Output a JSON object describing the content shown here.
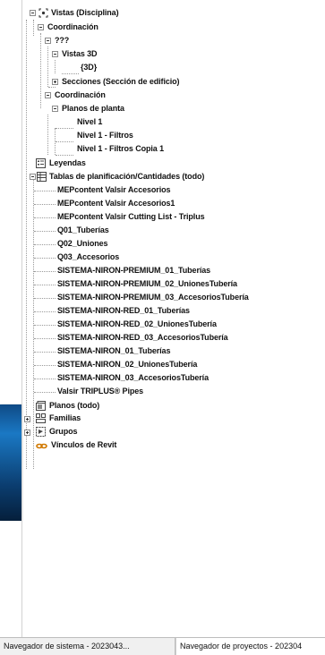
{
  "tree": {
    "vistas": "Vistas (Disciplina)",
    "coordinacion_1": "Coordinación",
    "unknown": "???",
    "vistas3d": "Vistas 3D",
    "view3d": "{3D}",
    "secciones": "Secciones (Sección de edificio)",
    "coordinacion_2": "Coordinación",
    "planos_planta": "Planos de planta",
    "nivel1": "Nivel 1",
    "nivel1_filtros": "Nivel 1 - Filtros",
    "nivel1_filtros_copia": "Nivel 1 - Filtros Copia 1",
    "leyendas": "Leyendas",
    "tablas": "Tablas de planificación/Cantidades (todo)",
    "schedules": [
      "MEPcontent Valsir Accesorios",
      "MEPcontent Valsir Accesorios1",
      "MEPcontent Valsir Cutting List - Triplus",
      "Q01_Tuberías",
      "Q02_Uniones",
      "Q03_Accesorios",
      "SISTEMA-NIRON-PREMIUM_01_Tuberías",
      "SISTEMA-NIRON-PREMIUM_02_UnionesTubería",
      "SISTEMA-NIRON-PREMIUM_03_AccesoriosTubería",
      "SISTEMA-NIRON-RED_01_Tuberías",
      "SISTEMA-NIRON-RED_02_UnionesTubería",
      "SISTEMA-NIRON-RED_03_AccesoriosTubería",
      "SISTEMA-NIRON_01_Tuberías",
      "SISTEMA-NIRON_02_UnionesTubería",
      "SISTEMA-NIRON_03_AccesoriosTubería",
      "Valsir TRIPLUS® Pipes"
    ],
    "planos": "Planos (todo)",
    "familias": "Familias",
    "grupos": "Grupos",
    "vinculos": "Vínculos de Revit"
  },
  "tabs": {
    "system_browser": "Navegador de sistema - 2023043...",
    "project_browser": "Navegador de proyectos - 202304"
  }
}
